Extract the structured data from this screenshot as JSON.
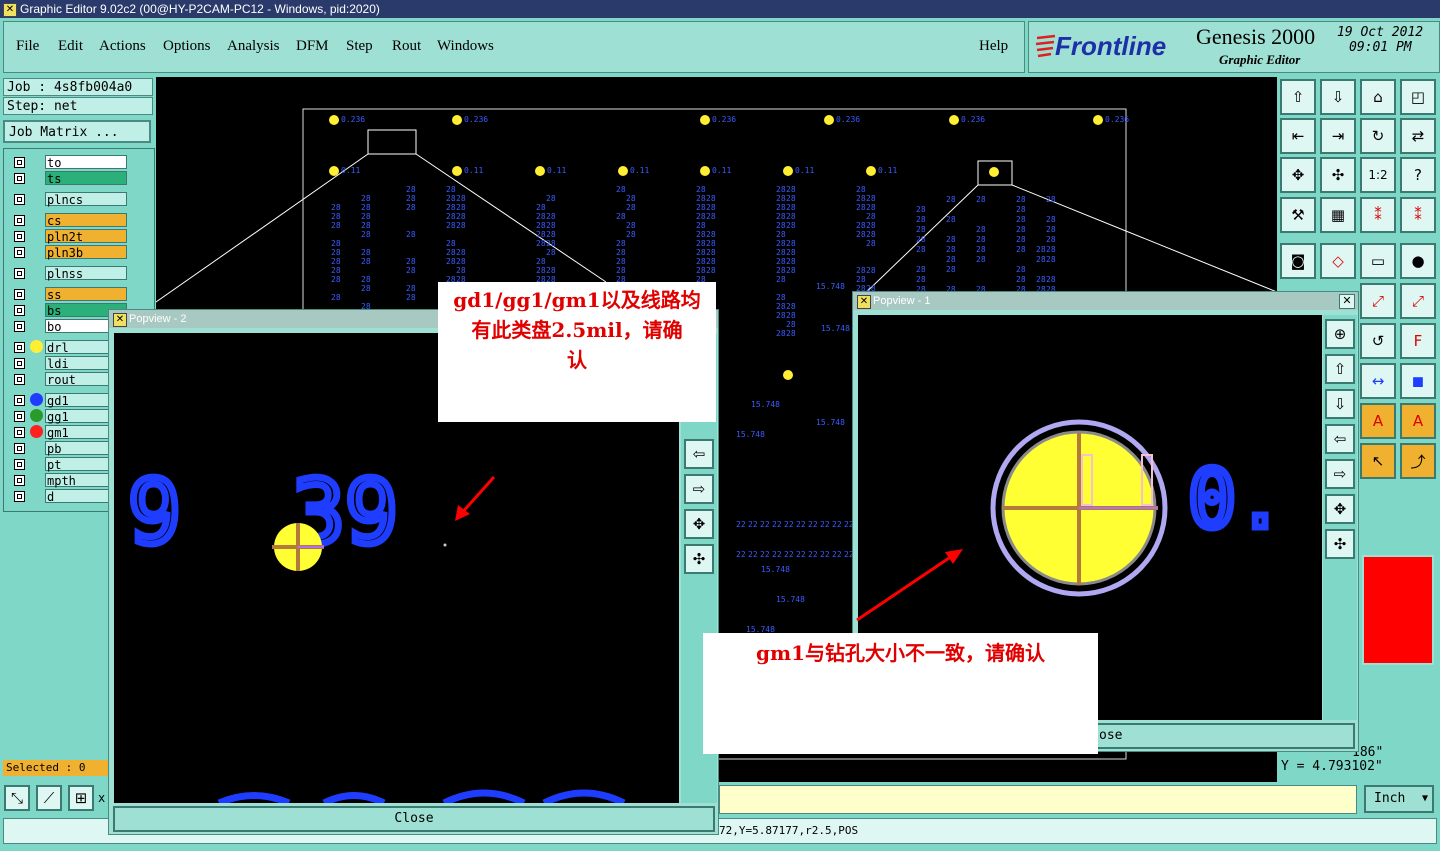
{
  "window": {
    "title": "Graphic Editor 9.02c2 (00@HY-P2CAM-PC12 - Windows, pid:2020)"
  },
  "menu": {
    "items": [
      "File",
      "Edit",
      "Actions",
      "Options",
      "Analysis",
      "DFM",
      "Step",
      "Rout",
      "Windows"
    ],
    "help": "Help"
  },
  "brand": {
    "logo": "Frontline",
    "product": "Genesis 2000",
    "subtitle": "Graphic Editor",
    "date": "19 Oct 2012",
    "time": "09:01 PM"
  },
  "job": {
    "job_line": "Job : 4s8fb004a0",
    "step_line": "Step: net",
    "matrix_button": "Job Matrix ..."
  },
  "layers": [
    {
      "name": "to",
      "color": "#ffffff",
      "dot": ""
    },
    {
      "name": "ts",
      "color": "#2bb07a",
      "dot": ""
    },
    {
      "name": "plncs",
      "color": "#bfefe6",
      "dot": ""
    },
    {
      "name": "cs",
      "color": "#f0b030",
      "dot": ""
    },
    {
      "name": "pln2t",
      "color": "#f0b030",
      "dot": ""
    },
    {
      "name": "pln3b",
      "color": "#f0b030",
      "dot": ""
    },
    {
      "name": "plnss",
      "color": "#bfefe6",
      "dot": ""
    },
    {
      "name": "ss",
      "color": "#f0b030",
      "dot": ""
    },
    {
      "name": "bs",
      "color": "#2bb07a",
      "dot": ""
    },
    {
      "name": "bo",
      "color": "#ffffff",
      "dot": ""
    },
    {
      "name": "drl",
      "color": "#bfefe6",
      "dot": "#ffee33"
    },
    {
      "name": "ldi",
      "color": "#bfefe6",
      "dot": ""
    },
    {
      "name": "rout",
      "color": "#bfefe6",
      "dot": ""
    },
    {
      "name": "gd1",
      "color": "#bfefe6",
      "dot": "#1f3dff"
    },
    {
      "name": "gg1",
      "color": "#bfefe6",
      "dot": "#2a9a2a"
    },
    {
      "name": "gm1",
      "color": "#bfefe6",
      "dot": "#ff2020"
    },
    {
      "name": "pb",
      "color": "#bfefe6",
      "dot": ""
    },
    {
      "name": "pt",
      "color": "#bfefe6",
      "dot": ""
    },
    {
      "name": "mpth",
      "color": "#bfefe6",
      "dot": ""
    },
    {
      "name": "d",
      "color": "#bfefe6",
      "dot": ""
    }
  ],
  "status": {
    "selected": "Selected : 0",
    "x_label": "x",
    "coords": "72,Y=5.87177,r2.5,POS",
    "x_readout": "186\"",
    "y_readout": "Y = 4.793102\"",
    "units": "Inch"
  },
  "popview1": {
    "title": "Popview - 1",
    "close": "ose",
    "digits": "0."
  },
  "popview2": {
    "title": "Popview - 2",
    "close": "Close",
    "digits_left": "9",
    "digits_right": "39"
  },
  "notes": {
    "note1_line1": "gd1/gg1/gm1以及线路均",
    "note1_line2": "有此类盘2.5mil，请确",
    "note1_line3": "认",
    "note2": "gm1与钻孔大小不一致，请确认"
  },
  "pads": {
    "top_label": "0.236",
    "mid_label": "0.11",
    "small_label": "15.748"
  }
}
